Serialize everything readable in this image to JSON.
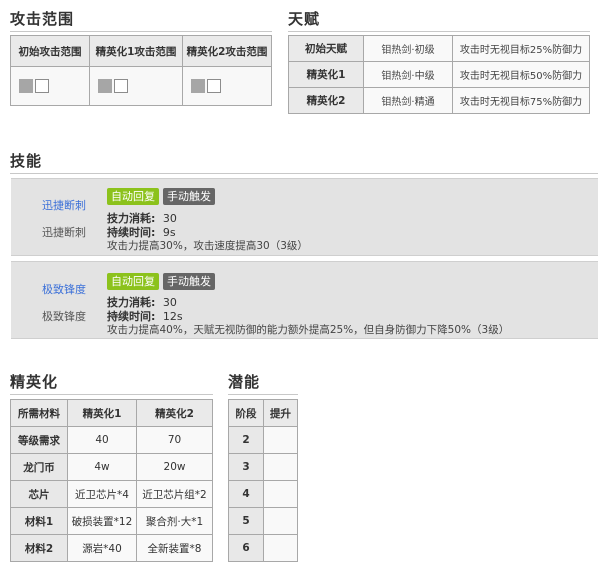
{
  "range": {
    "title": "攻击范围",
    "headers": [
      "初始攻击范围",
      "精英化1攻击范围",
      "精英化2攻击范围"
    ]
  },
  "talent": {
    "title": "天赋",
    "rows": [
      {
        "label": "初始天赋",
        "name": "钼热剑·初级",
        "effect": "攻击时无视目标25%防御力"
      },
      {
        "label": "精英化1",
        "name": "钼热剑·中级",
        "effect": "攻击时无视目标50%防御力"
      },
      {
        "label": "精英化2",
        "name": "钼热剑·精通",
        "effect": "攻击时无视目标75%防御力"
      }
    ]
  },
  "skills": {
    "title": "技能",
    "items": [
      {
        "link": "迅捷断刺",
        "name": "迅捷断刺",
        "tag1": "自动回复",
        "tag2": "手动触发",
        "cost_label": "技力消耗:",
        "cost": "30",
        "dur_label": "持续时间:",
        "dur": "9s",
        "desc": "攻击力提高30%，攻击速度提高30（3级）"
      },
      {
        "link": "极致锋度",
        "name": "极致锋度",
        "tag1": "自动回复",
        "tag2": "手动触发",
        "cost_label": "技力消耗:",
        "cost": "30",
        "dur_label": "持续时间:",
        "dur": "12s",
        "desc": "攻击力提高40%，天赋无视防御的能力额外提高25%，但自身防御力下降50%（3级）"
      }
    ]
  },
  "elite": {
    "title": "精英化",
    "headers": [
      "所需材料",
      "精英化1",
      "精英化2"
    ],
    "rows": [
      {
        "label": "等级需求",
        "e1": "40",
        "e2": "70"
      },
      {
        "label": "龙门币",
        "e1": "4w",
        "e2": "20w"
      },
      {
        "label": "芯片",
        "e1": "近卫芯片*4",
        "e2": "近卫芯片组*2"
      },
      {
        "label": "材料1",
        "e1": "破损装置*12",
        "e2": "聚合剂·大*1"
      },
      {
        "label": "材料2",
        "e1": "源岩*40",
        "e2": "全新装置*8"
      }
    ]
  },
  "potential": {
    "title": "潜能",
    "headers": [
      "阶段",
      "提升"
    ],
    "rows": [
      {
        "stage": "2",
        "boost": ""
      },
      {
        "stage": "3",
        "boost": ""
      },
      {
        "stage": "4",
        "boost": ""
      },
      {
        "stage": "5",
        "boost": ""
      },
      {
        "stage": "6",
        "boost": ""
      }
    ]
  }
}
